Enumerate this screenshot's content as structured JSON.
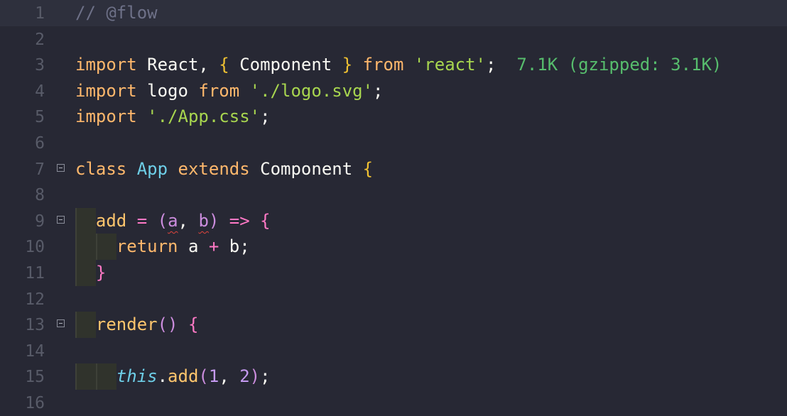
{
  "editor": {
    "file_language": "javascript",
    "colors": {
      "background": "#272834",
      "active_line": "#2e303d",
      "tab_indicator": "#e6c07b"
    },
    "lines": [
      {
        "num": "1",
        "tokens": [
          {
            "t": "// @flow",
            "c": "comment"
          }
        ]
      },
      {
        "num": "2",
        "tokens": []
      },
      {
        "num": "3",
        "tokens": [
          {
            "t": "import",
            "c": "kw"
          },
          {
            "t": " React, ",
            "c": "plain"
          },
          {
            "t": "{",
            "c": "brace"
          },
          {
            "t": " Component ",
            "c": "plain"
          },
          {
            "t": "}",
            "c": "brace"
          },
          {
            "t": " ",
            "c": "plain"
          },
          {
            "t": "from",
            "c": "kw"
          },
          {
            "t": " ",
            "c": "plain"
          },
          {
            "t": "'react'",
            "c": "str"
          },
          {
            "t": ";  ",
            "c": "plain"
          },
          {
            "t": "7.1K (gzipped: 3.1K)",
            "c": "size"
          }
        ]
      },
      {
        "num": "4",
        "tokens": [
          {
            "t": "import",
            "c": "kw"
          },
          {
            "t": " logo ",
            "c": "plain"
          },
          {
            "t": "from",
            "c": "kw"
          },
          {
            "t": " ",
            "c": "plain"
          },
          {
            "t": "'./logo.svg'",
            "c": "str"
          },
          {
            "t": ";",
            "c": "plain"
          }
        ]
      },
      {
        "num": "5",
        "tokens": [
          {
            "t": "import",
            "c": "kw"
          },
          {
            "t": " ",
            "c": "plain"
          },
          {
            "t": "'./App.css'",
            "c": "str"
          },
          {
            "t": ";",
            "c": "plain"
          }
        ]
      },
      {
        "num": "6",
        "tokens": []
      },
      {
        "num": "7",
        "fold": true,
        "tokens": [
          {
            "t": "class",
            "c": "kw"
          },
          {
            "t": " ",
            "c": "plain"
          },
          {
            "t": "App",
            "c": "class"
          },
          {
            "t": " ",
            "c": "plain"
          },
          {
            "t": "extends",
            "c": "kw"
          },
          {
            "t": " Component ",
            "c": "plain"
          },
          {
            "t": "{",
            "c": "brace"
          }
        ]
      },
      {
        "num": "8",
        "tokens": []
      },
      {
        "num": "9",
        "fold": true,
        "guides": 1,
        "tokens": [
          {
            "t": "  ",
            "c": "plain"
          },
          {
            "t": "add",
            "c": "func"
          },
          {
            "t": " = ",
            "c": "op"
          },
          {
            "t": "(",
            "c": "param"
          },
          {
            "t": "a",
            "c": "param",
            "squig": true
          },
          {
            "t": ", ",
            "c": "plain"
          },
          {
            "t": "b",
            "c": "param",
            "squig": true
          },
          {
            "t": ")",
            "c": "param"
          },
          {
            "t": " => ",
            "c": "op"
          },
          {
            "t": "{",
            "c": "pink"
          }
        ]
      },
      {
        "num": "10",
        "guides": 2,
        "tokens": [
          {
            "t": "    ",
            "c": "plain"
          },
          {
            "t": "return",
            "c": "kw"
          },
          {
            "t": " a ",
            "c": "plain"
          },
          {
            "t": "+",
            "c": "op"
          },
          {
            "t": " b;",
            "c": "plain"
          }
        ]
      },
      {
        "num": "11",
        "guides": 1,
        "tokens": [
          {
            "t": "  ",
            "c": "plain"
          },
          {
            "t": "}",
            "c": "pink"
          }
        ]
      },
      {
        "num": "12",
        "tokens": []
      },
      {
        "num": "13",
        "fold": true,
        "guides": 1,
        "tokens": [
          {
            "t": "  ",
            "c": "plain"
          },
          {
            "t": "render",
            "c": "func"
          },
          {
            "t": "()",
            "c": "param"
          },
          {
            "t": " ",
            "c": "plain"
          },
          {
            "t": "{",
            "c": "pink"
          }
        ]
      },
      {
        "num": "14",
        "tokens": []
      },
      {
        "num": "15",
        "guides": 2,
        "tokens": [
          {
            "t": "    ",
            "c": "plain"
          },
          {
            "t": "this",
            "c": "this"
          },
          {
            "t": ".",
            "c": "plain"
          },
          {
            "t": "add",
            "c": "func"
          },
          {
            "t": "(",
            "c": "param"
          },
          {
            "t": "1",
            "c": "num"
          },
          {
            "t": ", ",
            "c": "plain"
          },
          {
            "t": "2",
            "c": "num"
          },
          {
            "t": ")",
            "c": "param"
          },
          {
            "t": ";",
            "c": "plain"
          }
        ]
      },
      {
        "num": "16",
        "tokens": []
      }
    ]
  }
}
